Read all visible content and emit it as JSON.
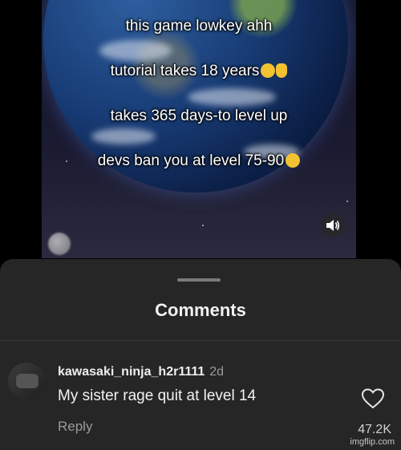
{
  "video": {
    "caption_lines": [
      "this game lowkey ahh",
      "tutorial takes 18 years",
      "takes 365 days-to level up",
      "devs ban you at level 75-90"
    ],
    "icons": {
      "line2_emojis": [
        "grinning-emoji-icon",
        "victory-hand-emoji-icon"
      ],
      "line4_emoji": "weary-face-emoji-icon",
      "volume": "volume-icon"
    }
  },
  "comments_sheet": {
    "title": "Comments",
    "comment": {
      "username": "kawasaki_ninja_h2r1111",
      "time": "2d",
      "text": "My sister rage quit at level 14",
      "reply_label": "Reply",
      "likes": "47.2K",
      "like_icon": "heart-outline-icon"
    }
  },
  "watermark": "imgflip.com",
  "colors": {
    "sheet_background": "#262626",
    "primary_text": "#f2f2f2",
    "secondary_text": "#9a9a9a",
    "emoji_yellow": "#f2c230"
  }
}
